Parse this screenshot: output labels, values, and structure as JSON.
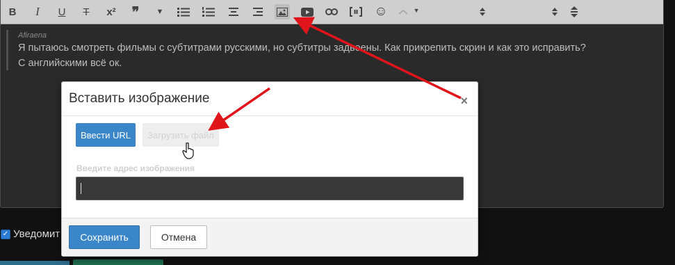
{
  "toolbar": {
    "buttons": [
      {
        "name": "bold-icon",
        "glyph": "B"
      },
      {
        "name": "italic-icon",
        "glyph": "I"
      },
      {
        "name": "underline-icon",
        "glyph": "U"
      },
      {
        "name": "strikethrough-icon",
        "glyph": "T"
      },
      {
        "name": "superscript-icon",
        "glyph": "x²"
      },
      {
        "name": "quote-icon",
        "glyph": "❞"
      },
      {
        "name": "more-dropdown-icon",
        "glyph": "▼"
      },
      {
        "name": "bullet-list-icon",
        "glyph": ""
      },
      {
        "name": "numbered-list-icon",
        "glyph": ""
      },
      {
        "name": "align-center-icon",
        "glyph": ""
      },
      {
        "name": "align-right-icon",
        "glyph": ""
      },
      {
        "name": "insert-image-icon",
        "glyph": ""
      },
      {
        "name": "insert-video-icon",
        "glyph": ""
      },
      {
        "name": "insert-link-icon",
        "glyph": ""
      },
      {
        "name": "code-icon",
        "glyph": ""
      },
      {
        "name": "emoji-icon",
        "glyph": "☺"
      }
    ]
  },
  "editor": {
    "quote_author": "Afiraena",
    "line1": "Я пытаюсь смотреть фильмы с субтитрами русскими, но субтитры задвоены. Как прикрепить скрин и как это исправить?",
    "line2": "С английскими всё ок."
  },
  "notify": {
    "label": "Уведомит"
  },
  "modal": {
    "title": "Вставить изображение",
    "close": "×",
    "tab_url": "Ввести URL",
    "tab_file": "Загрузить файл",
    "url_label": "Введите адрес изображения",
    "url_value": "",
    "save": "Сохранить",
    "cancel": "Отмена"
  },
  "colors": {
    "accent": "#3b86c8",
    "annotation_arrow": "#e0141b"
  }
}
